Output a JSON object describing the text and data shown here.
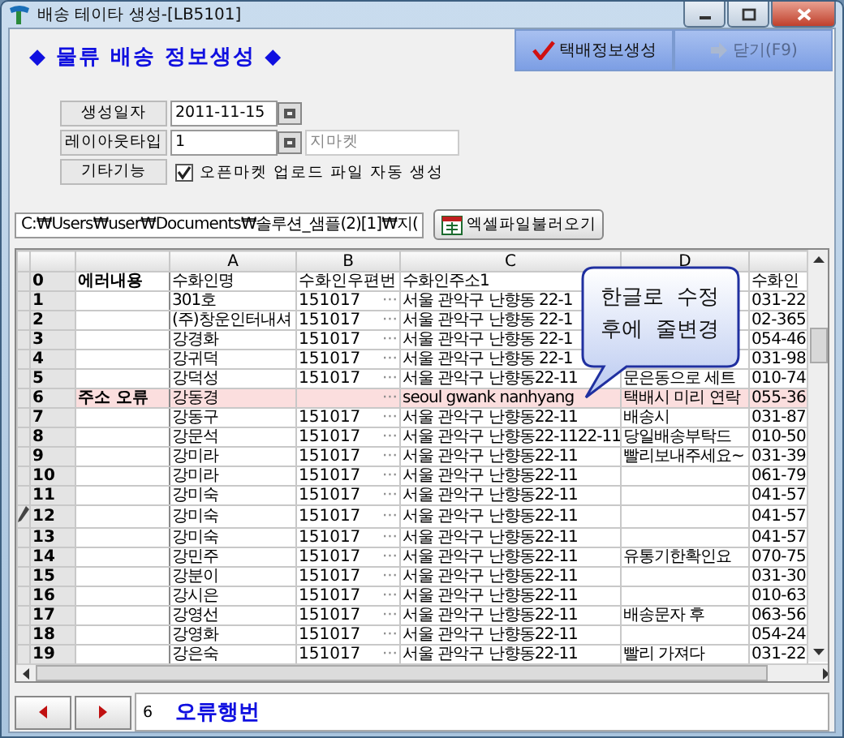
{
  "window": {
    "title": "배송 테이타 생성-[LB5101]"
  },
  "heading": "◆ 물류 배송 정보생성 ◆",
  "toolbar": [
    {
      "label": "택배정보생성",
      "disabled": false,
      "kind": "check"
    },
    {
      "label": "닫기(F9)",
      "disabled": true,
      "kind": "door"
    }
  ],
  "form": {
    "date": {
      "label": "생성일자",
      "value": "2011-11-15"
    },
    "layout": {
      "label": "레이아웃타입",
      "value": "1",
      "name": "지마켓"
    },
    "options": {
      "label": "기타기능",
      "checkbox": "오픈마켓 업로드 파일 자동 생성",
      "checked": true
    }
  },
  "file": {
    "path": "C:₩Users₩user₩Documents₩솔루션_샘플(2)[1]₩지(",
    "button": "엑셀파일불러오기"
  },
  "grid": {
    "columns": [
      "A",
      "B",
      "C",
      "D"
    ],
    "rows": [
      {
        "number": "0",
        "error": "에러내용",
        "a": "수화인명",
        "b": "수화인우편번",
        "c": "수화인주소1",
        "d": "",
        "e": "수화인",
        "highlighted": false,
        "editing": false
      },
      {
        "number": "1",
        "error": "",
        "a": "301호",
        "b": "151017",
        "button": "···",
        "c": "서울 관악구 난향동 22-1",
        "d": "",
        "e": "031-22",
        "highlighted": false,
        "editing": false
      },
      {
        "number": "2",
        "error": "",
        "a": "(주)창운인터내셔",
        "b": "151017",
        "button": "···",
        "c": "서울 관악구 난향동 22-1",
        "d": "",
        "e": "02-365",
        "highlighted": false,
        "editing": false
      },
      {
        "number": "3",
        "error": "",
        "a": "강경화",
        "b": "151017",
        "button": "···",
        "c": "서울 관악구 난향동 22-1",
        "d": "",
        "e": "054-46",
        "highlighted": false,
        "editing": false
      },
      {
        "number": "4",
        "error": "",
        "a": "강귀덕",
        "b": "151017",
        "button": "···",
        "c": "서울 관악구 난향동 22-1",
        "d": "",
        "e": "031-98",
        "highlighted": false,
        "editing": false
      },
      {
        "number": "5",
        "error": "",
        "a": "강덕성",
        "b": "151017",
        "button": "···",
        "c": "서울 관악구 난향동22-11",
        "d": "문은동으로 세트",
        "e": "010-74",
        "highlighted": false,
        "editing": false
      },
      {
        "number": "6",
        "error": "주소 오류",
        "a": "강동경",
        "b": "",
        "button": "···",
        "c": "seoul gwank nanhyang",
        "d": "택배시 미리 연락",
        "e": "055-36",
        "highlighted": true,
        "editing": false
      },
      {
        "number": "7",
        "error": "",
        "a": "강동구",
        "b": "151017",
        "button": "···",
        "c": "서울 관악구 난향동22-11",
        "d": "배송시",
        "e": "031-87",
        "highlighted": false,
        "editing": false
      },
      {
        "number": "8",
        "error": "",
        "a": "강문석",
        "b": "151017",
        "button": "···",
        "c": "서울 관악구 난향동22-1122-11",
        "d": "당일배송부탁드",
        "e": "010-50",
        "highlighted": false,
        "editing": false
      },
      {
        "number": "9",
        "error": "",
        "a": "강미라",
        "b": "151017",
        "button": "···",
        "c": "서울 관악구 난향동22-11",
        "d": "빨리보내주세요~",
        "e": "031-39",
        "highlighted": false,
        "editing": false
      },
      {
        "number": "10",
        "error": "",
        "a": "강미라",
        "b": "151017",
        "button": "···",
        "c": "서울 관악구 난향동22-11",
        "d": "",
        "e": "061-79",
        "highlighted": false,
        "editing": false
      },
      {
        "number": "11",
        "error": "",
        "a": "강미숙",
        "b": "151017",
        "button": "···",
        "c": "서울 관악구 난향동22-11",
        "d": "",
        "e": "041-57",
        "highlighted": false,
        "editing": false
      },
      {
        "number": "12",
        "error": "",
        "a": "강미숙",
        "b": "151017",
        "button": "···",
        "c": "서울 관악구 난향동22-11",
        "d": "",
        "e": "041-57",
        "highlighted": false,
        "editing": true
      },
      {
        "number": "13",
        "error": "",
        "a": "강미숙",
        "b": "151017",
        "button": "···",
        "c": "서울 관악구 난향동22-11",
        "d": "",
        "e": "041-57",
        "highlighted": false,
        "editing": false
      },
      {
        "number": "14",
        "error": "",
        "a": "강민주",
        "b": "151017",
        "button": "···",
        "c": "서울 관악구 난향동22-11",
        "d": "유통기한확인요",
        "e": "070-75",
        "highlighted": false,
        "editing": false
      },
      {
        "number": "15",
        "error": "",
        "a": "강분이",
        "b": "151017",
        "button": "···",
        "c": "서울 관악구 난향동22-11",
        "d": "",
        "e": "031-30",
        "highlighted": false,
        "editing": false
      },
      {
        "number": "16",
        "error": "",
        "a": "강시은",
        "b": "151017",
        "button": "···",
        "c": "서울 관악구 난향동22-11",
        "d": "",
        "e": "010-63",
        "highlighted": false,
        "editing": false
      },
      {
        "number": "17",
        "error": "",
        "a": "강영선",
        "b": "151017",
        "button": "···",
        "c": "서울 관악구 난향동22-11",
        "d": "배송문자 후",
        "e": "063-56",
        "highlighted": false,
        "editing": false
      },
      {
        "number": "18",
        "error": "",
        "a": "강영화",
        "b": "151017",
        "button": "···",
        "c": "서울 관악구 난향동22-11",
        "d": "",
        "e": "054-24",
        "highlighted": false,
        "editing": false
      },
      {
        "number": "19",
        "error": "",
        "a": "강은숙",
        "b": "151017",
        "button": "···",
        "c": "서울 관악구 난향동22-11",
        "d": "빨리 가져다",
        "e": "031-22",
        "highlighted": false,
        "editing": false
      }
    ]
  },
  "callout": [
    "한글로 수정",
    "후에 줄변경"
  ],
  "footer": {
    "row": "6",
    "label": "오류행번"
  }
}
